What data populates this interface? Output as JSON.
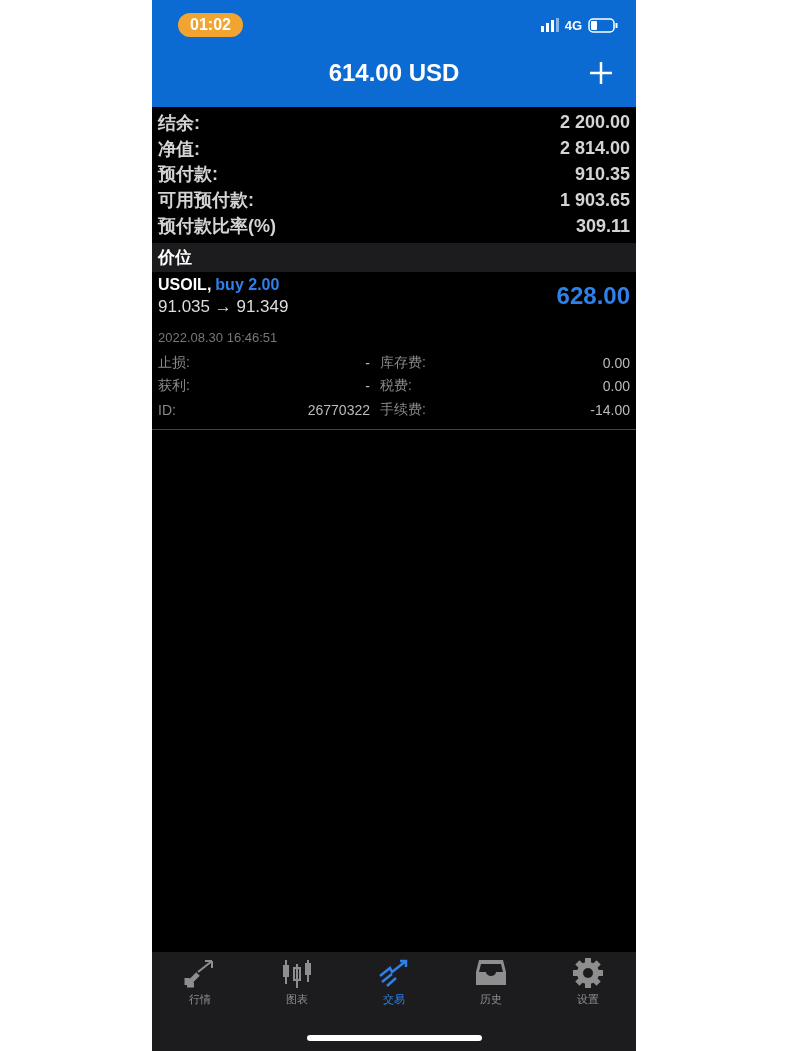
{
  "status_bar": {
    "time": "01:02",
    "network": "4G"
  },
  "header": {
    "title": "614.00 USD"
  },
  "summary": [
    {
      "label": "结余:",
      "value": "2 200.00"
    },
    {
      "label": "净值:",
      "value": "2 814.00"
    },
    {
      "label": "预付款:",
      "value": "910.35"
    },
    {
      "label": "可用预付款:",
      "value": "1 903.65"
    },
    {
      "label": "预付款比率(%)",
      "value": "309.11"
    }
  ],
  "section": {
    "title": "价位"
  },
  "positions": [
    {
      "symbol": "USOIL,",
      "side": "buy 2.00",
      "prices": "91.035 → 91.349",
      "profit": "628.00",
      "time": "2022.08.30 16:46:51",
      "details": [
        {
          "label": "止损:",
          "value": "-",
          "label2": "库存费:",
          "value2": "0.00"
        },
        {
          "label": "获利:",
          "value": "-",
          "label2": "税费:",
          "value2": "0.00"
        },
        {
          "label": "ID:",
          "value": "26770322",
          "label2": "手续费:",
          "value2": "-14.00"
        }
      ]
    }
  ],
  "tabs": [
    {
      "label": "行情",
      "selected": false
    },
    {
      "label": "图表",
      "selected": false
    },
    {
      "label": "交易",
      "selected": true
    },
    {
      "label": "历史",
      "selected": false
    },
    {
      "label": "设置",
      "selected": false
    }
  ]
}
